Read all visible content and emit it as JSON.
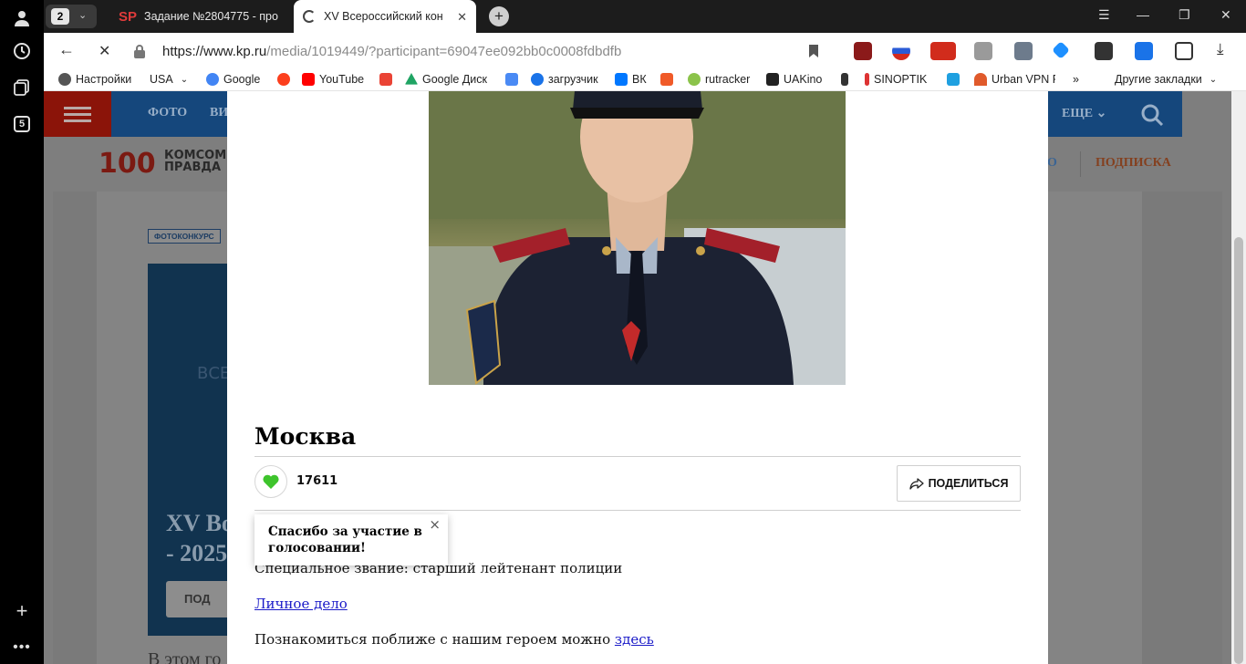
{
  "browser": {
    "tab_count": "2",
    "tabs": [
      {
        "favicon_text": "SP",
        "title": "Задание №2804775 - про"
      },
      {
        "title": "XV Всероссийский кон"
      }
    ],
    "url_host": "https://www.kp.ru",
    "url_path": "/media/1019449/?participant=69047ee092bb0c0008fdbdfb",
    "sidebar_badge": "5"
  },
  "bookmarks": [
    {
      "label": "Настройки",
      "color": "#555555"
    },
    {
      "label": "USA",
      "color": "#ffffff"
    },
    {
      "label": "Google",
      "color": "#4285f4"
    },
    {
      "label": "",
      "color": "#fc3f1d"
    },
    {
      "label": "YouTube",
      "color": "#ff0000"
    },
    {
      "label": "",
      "color": "#ea4335"
    },
    {
      "label": "Google Диск",
      "color": "#1fa463"
    },
    {
      "label": "",
      "color": "#4a8af4"
    },
    {
      "label": "загрузчик",
      "color": "#1a73e8"
    },
    {
      "label": "ВК",
      "color": "#0077ff"
    },
    {
      "label": "",
      "color": "#f05a28"
    },
    {
      "label": "rutracker",
      "color": "#8bc34a"
    },
    {
      "label": "UAKino",
      "color": "#222222"
    },
    {
      "label": "",
      "color": "#333333"
    },
    {
      "label": "SINOPTIK",
      "color": "#ffffff"
    },
    {
      "label": "",
      "color": "#1fa0e0"
    },
    {
      "label": "Urban VPN P",
      "color": "#e05a2b"
    }
  ],
  "bookmarks_more": "»",
  "bookmarks_other": "Другие закладки",
  "site": {
    "nav": [
      "ФОТО",
      "ВИ"
    ],
    "nav_more": "ЕЩЕ",
    "logo_number": "100",
    "logo_lines": [
      "КОМСОМ",
      "ПРАВДА"
    ],
    "subscribe": "ПОДПИСКА",
    "subscribe_prefix": "О",
    "badge": "ФОТОКОНКУРС",
    "card_title_lines": [
      "XV Во",
      "- 2025"
    ],
    "card_vse": "ВСЕ",
    "card_button": "ПОД",
    "bottom_text": "В этом го"
  },
  "modal": {
    "city": "Москва",
    "votes": "17611",
    "share_label": "ПОДЕЛИТЬСЯ",
    "toast_text": "Спасибо за участие в голосовании!",
    "rank": "Специальное звание: старший лейтенант полиции",
    "dossier_link": "Личное дело",
    "meet_text": "Познакомиться поближе с нашим героем можно ",
    "meet_link": "здесь"
  },
  "colors": {
    "kp_red": "#8b1409",
    "kp_blue": "#15477c",
    "like_green": "#3ec42c",
    "link_blue": "#1a1ac8"
  }
}
